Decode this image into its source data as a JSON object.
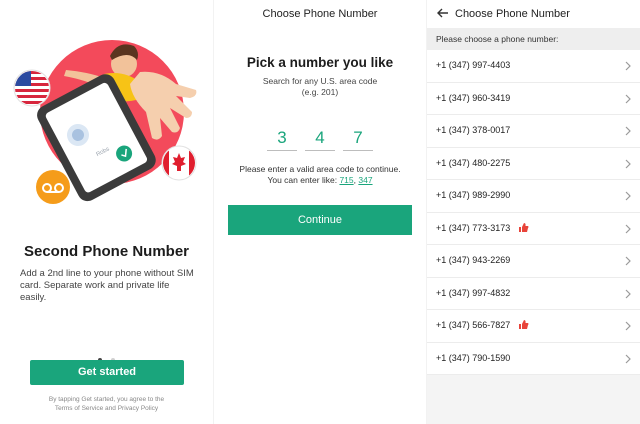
{
  "onboarding": {
    "title": "Second Phone Number",
    "description": "Add a 2nd line to your phone without SIM card. Separate work and private life easily.",
    "caller_label": "Robs",
    "get_started_label": "Get started",
    "terms_line1": "By tapping Get started, you agree to the",
    "terms_line2": "Terms of Service and Privacy Policy",
    "page_dots": 2,
    "active_dot": 0
  },
  "pick": {
    "topbar_title": "Choose Phone Number",
    "heading": "Pick a number you like",
    "subtitle_line1": "Search for any U.S. area code",
    "subtitle_line2": "(e.g. 201)",
    "digits": [
      "3",
      "4",
      "7"
    ],
    "hint_line1": "Please enter a valid area code to continue.",
    "hint_line2_prefix": "You can enter like: ",
    "suggestion1": "715",
    "suggestion_sep": ", ",
    "suggestion2": "347",
    "continue_label": "Continue"
  },
  "numbers": {
    "topbar_title": "Choose Phone Number",
    "section_label": "Please choose a phone number:",
    "items": [
      {
        "number": "+1 (347) 997-4403",
        "liked": false
      },
      {
        "number": "+1 (347) 960-3419",
        "liked": false
      },
      {
        "number": "+1 (347) 378-0017",
        "liked": false
      },
      {
        "number": "+1 (347) 480-2275",
        "liked": false
      },
      {
        "number": "+1 (347) 989-2990",
        "liked": false
      },
      {
        "number": "+1 (347) 773-3173",
        "liked": true
      },
      {
        "number": "+1 (347) 943-2269",
        "liked": false
      },
      {
        "number": "+1 (347) 997-4832",
        "liked": false
      },
      {
        "number": "+1 (347) 566-7827",
        "liked": true
      },
      {
        "number": "+1 (347) 790-1590",
        "liked": false
      }
    ]
  },
  "colors": {
    "accent": "#1aa57c",
    "badge_red": "#e8443a",
    "voicemail_orange": "#f59c1a"
  }
}
